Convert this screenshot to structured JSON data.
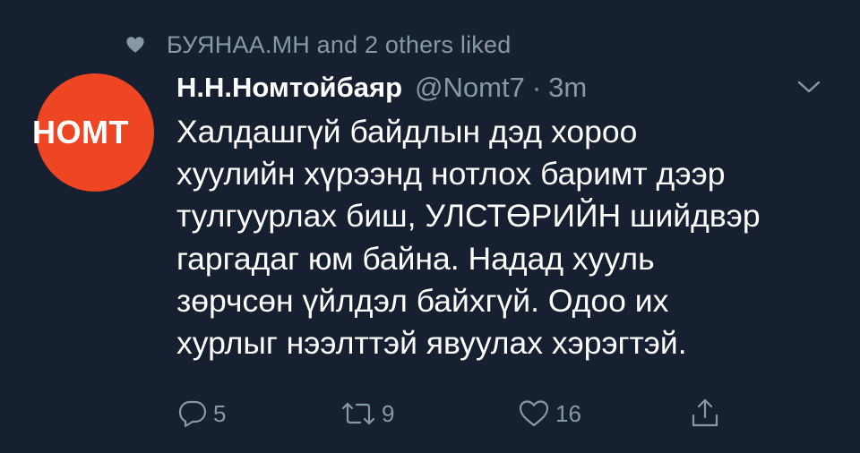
{
  "social_context": {
    "text": "БУЯНАА.МН and 2 others liked",
    "icon": "heart-icon"
  },
  "avatar": {
    "logo_text": "НОМТ",
    "bg_color": "#ee4523"
  },
  "author": {
    "display_name": "Н.Н.Номтойбаяр",
    "handle": "@Nomt7",
    "separator": "·",
    "time": "3m"
  },
  "tweet": {
    "lines": [
      "Халдашгүй байдлын дэд хороо",
      "хуулийн хүрээнд нотлох баримт дээр",
      "тулгуурлах биш, УЛСТӨРИЙН шийдвэр",
      "гаргадаг юм байна. Надад хууль",
      "зөрчсөн үйлдэл байхгүй. Одоо их",
      "хурлыг нээлттэй явуулах хэрэгтэй."
    ]
  },
  "actions": {
    "reply_count": "5",
    "retweet_count": "9",
    "like_count": "16"
  },
  "colors": {
    "background": "#162030",
    "muted": "#8899a6",
    "text": "#ffffff"
  }
}
